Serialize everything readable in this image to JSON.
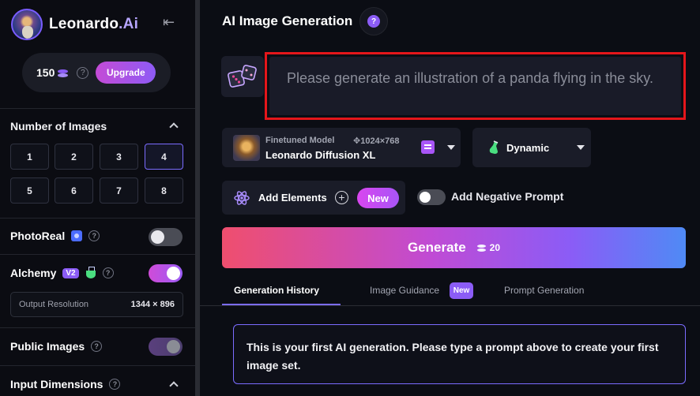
{
  "sidebar": {
    "brand": {
      "name": "Leonardo",
      "suffix": ".Ai"
    },
    "collapse_glyph": "⇤",
    "credits": {
      "amount": "150",
      "upgrade_label": "Upgrade"
    },
    "num_images": {
      "title": "Number of Images",
      "options": [
        "1",
        "2",
        "3",
        "4",
        "5",
        "6",
        "7",
        "8"
      ],
      "selected": "4"
    },
    "photoreal": {
      "label": "PhotoReal",
      "enabled": false
    },
    "alchemy": {
      "label": "Alchemy",
      "badge": "V2",
      "enabled": true
    },
    "output_resolution": {
      "label": "Output Resolution",
      "value": "1344 × 896"
    },
    "public_images": {
      "label": "Public Images",
      "enabled": true
    },
    "input_dimensions": {
      "label": "Input Dimensions"
    }
  },
  "main": {
    "title": "AI Image Generation",
    "prompt": {
      "placeholder": "Please generate an illustration of a panda flying in the sky."
    },
    "model": {
      "caption": "Finetuned Model",
      "dimensions": "1024×768",
      "name": "Leonardo Diffusion XL"
    },
    "style": {
      "label": "Dynamic"
    },
    "elements": {
      "label": "Add Elements",
      "new_badge": "New"
    },
    "negative_prompt": {
      "label": "Add Negative Prompt",
      "enabled": false
    },
    "generate": {
      "label": "Generate",
      "cost": "20"
    },
    "tabs": [
      {
        "label": "Generation History",
        "active": true
      },
      {
        "label": "Image Guidance",
        "badge": "New"
      },
      {
        "label": "Prompt Generation"
      }
    ],
    "info_message": "This is your first AI generation. Please type a prompt above to create your first image set."
  },
  "colors": {
    "accent": "#8b5cf6",
    "highlight_border": "#e5161b",
    "bg": "#0b0d14"
  }
}
